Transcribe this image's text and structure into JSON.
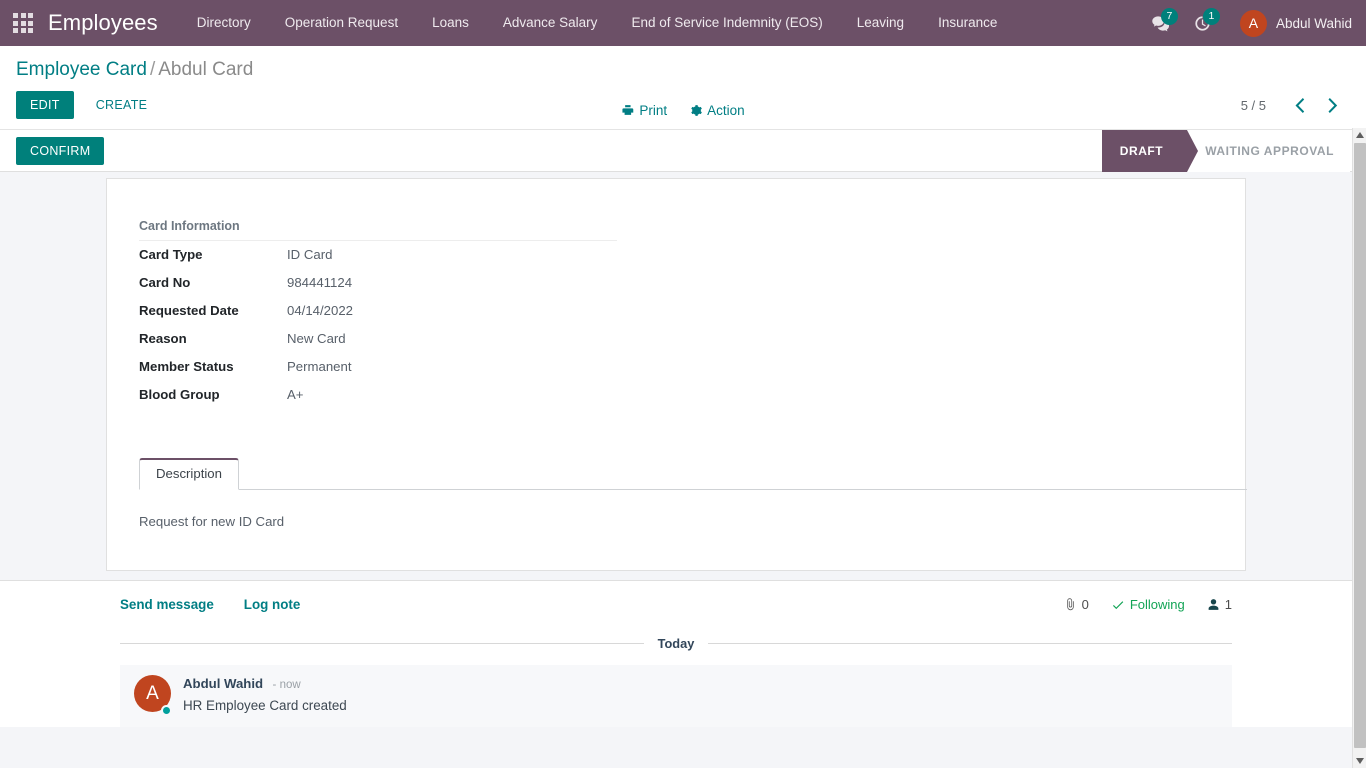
{
  "navbar": {
    "apps_icon": "apps-grid-icon",
    "brand": "Employees",
    "menu": [
      {
        "label": "Directory"
      },
      {
        "label": "Operation Request"
      },
      {
        "label": "Loans"
      },
      {
        "label": "Advance Salary"
      },
      {
        "label": "End of Service Indemnity (EOS)"
      },
      {
        "label": "Leaving"
      },
      {
        "label": "Insurance"
      }
    ],
    "messages_icon": "messages-bubble-icon",
    "messages_count": "7",
    "activity_icon": "activity-clock-icon",
    "activity_count": "1",
    "user_initial": "A",
    "user_name": "Abdul Wahid",
    "bg_color": "#6c5067",
    "badge_color": "#00807b"
  },
  "control_panel": {
    "breadcrumb_root": "Employee Card",
    "breadcrumb_sep": "/",
    "breadcrumb_current": "Abdul Card",
    "edit_label": "EDIT",
    "create_label": "CREATE",
    "print_label": "Print",
    "print_icon": "printer-icon",
    "action_label": "Action",
    "action_icon": "gear-icon",
    "pager_value": "5 / 5",
    "prev_icon": "chevron-left-icon",
    "next_icon": "chevron-right-icon",
    "accent_color": "#017e84"
  },
  "statusbar": {
    "confirm_label": "CONFIRM",
    "stages": [
      {
        "label": "DRAFT",
        "active": true
      },
      {
        "label": "WAITING APPROVAL",
        "active": false
      }
    ],
    "active_color": "#6c5067"
  },
  "form": {
    "group_title": "Card Information",
    "fields": [
      {
        "label": "Card Type",
        "value": "ID Card"
      },
      {
        "label": "Card No",
        "value": "984441124"
      },
      {
        "label": "Requested Date",
        "value": "04/14/2022"
      },
      {
        "label": "Reason",
        "value": "New Card"
      },
      {
        "label": "Member Status",
        "value": "Permanent"
      },
      {
        "label": "Blood Group",
        "value": "A+"
      }
    ],
    "tabs": [
      {
        "label": "Description",
        "active": true
      }
    ],
    "description_text": "Request for new ID Card"
  },
  "chatter": {
    "send_message_label": "Send message",
    "log_note_label": "Log note",
    "attachment_icon": "paperclip-icon",
    "attachment_count": "0",
    "following_icon": "check-icon",
    "following_label": "Following",
    "followers_icon": "user-icon",
    "followers_count": "1",
    "date_separator": "Today",
    "messages": [
      {
        "avatar_initial": "A",
        "author": "Abdul Wahid",
        "time": "- now",
        "body": "HR Employee Card created"
      }
    ],
    "following_color": "#13a456"
  },
  "scrollbar": {
    "up_icon": "scroll-up-arrow-icon",
    "down_icon": "scroll-down-arrow-icon",
    "thumb": "scrollbar-thumb"
  }
}
